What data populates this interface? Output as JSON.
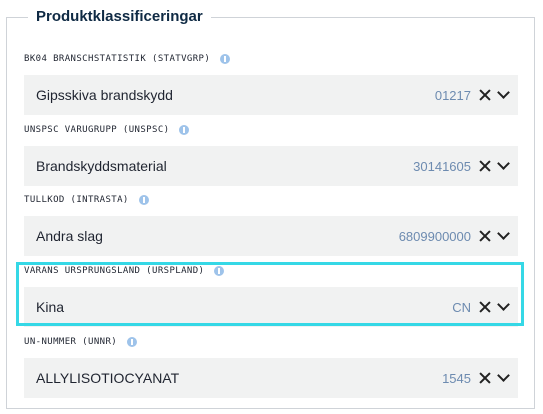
{
  "section": {
    "title": "Produktklassificeringar"
  },
  "fields": [
    {
      "label": "BK04 BRANSCHSTATISTIK (STATVGRP)",
      "value": "Gipsskiva brandskydd",
      "code": "01217"
    },
    {
      "label": "UNSPSC VARUGRUPP (UNSPSC)",
      "value": "Brandskyddsmaterial",
      "code": "30141605"
    },
    {
      "label": "TULLKOD (INTRASTA)",
      "value": "Andra slag",
      "code": "6809900000"
    },
    {
      "label": "VARANS URSPRUNGSLAND (URSPLAND)",
      "value": "Kina",
      "code": "CN"
    },
    {
      "label": "UN-NUMMER (UNNR)",
      "value": "ALLYLISOTIOCYANAT",
      "code": "1545"
    }
  ],
  "colors": {
    "accent_highlight": "#35d8e6",
    "code_text": "#6d8bb0",
    "info_icon": "#9ec3ea",
    "field_bg": "#f1f2f2"
  }
}
